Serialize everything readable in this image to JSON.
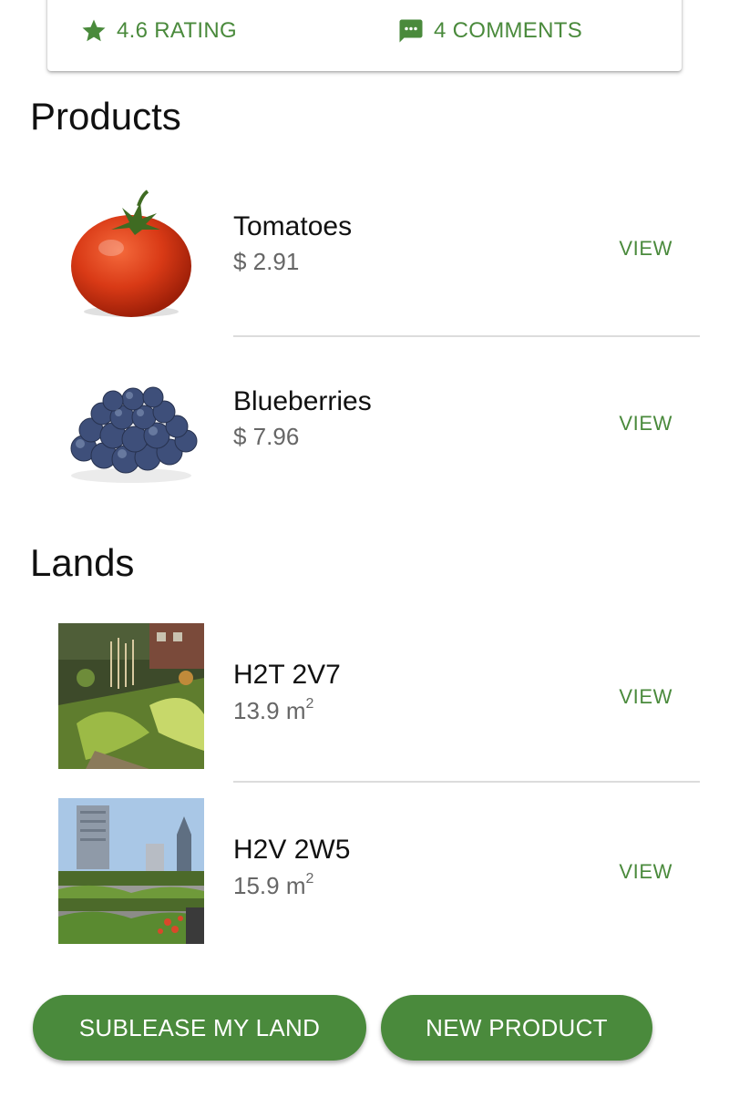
{
  "stats": {
    "rating_label": "4.6 RATING",
    "comments_label": "4 COMMENTS",
    "rating_icon": "star-icon",
    "comments_icon": "comment-icon"
  },
  "products": {
    "title": "Products",
    "items": [
      {
        "name": "Tomatoes",
        "price": "$ 2.91",
        "action": "VIEW",
        "image": "tomato-image"
      },
      {
        "name": "Blueberries",
        "price": "$ 7.96",
        "action": "VIEW",
        "image": "blueberries-image"
      }
    ]
  },
  "lands": {
    "title": "Lands",
    "items": [
      {
        "code": "H2T 2V7",
        "area": "13.9 m",
        "unit_sup": "2",
        "action": "VIEW",
        "image": "garden-image"
      },
      {
        "code": "H2V 2W5",
        "area": "15.9 m",
        "unit_sup": "2",
        "action": "VIEW",
        "image": "rooftop-garden-image"
      }
    ]
  },
  "actions": {
    "sublease_label": "SUBLEASE MY LAND",
    "new_product_label": "NEW PRODUCT"
  },
  "colors": {
    "accent": "#4a8a3c",
    "text_primary": "#111111",
    "text_secondary": "#666666",
    "divider": "#dcdcdc"
  }
}
